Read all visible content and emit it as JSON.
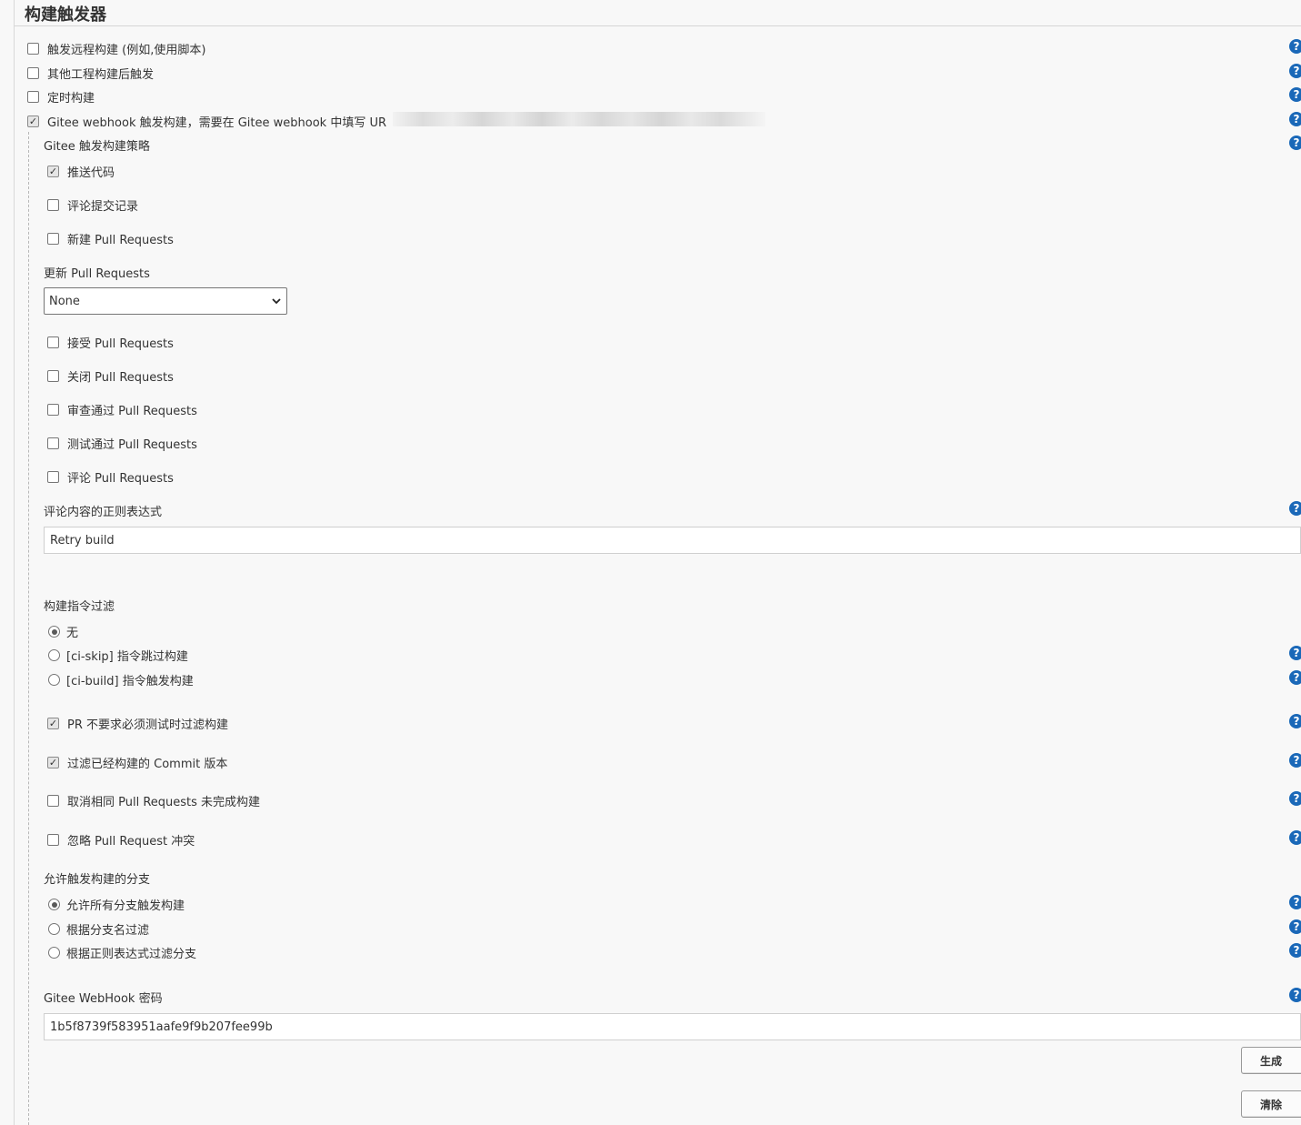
{
  "section": {
    "title": "构建触发器"
  },
  "triggers": [
    {
      "label": "触发远程构建 (例如,使用脚本)",
      "checked": false
    },
    {
      "label": "其他工程构建后触发",
      "checked": false
    },
    {
      "label": "定时构建",
      "checked": false
    },
    {
      "label": "Gitee webhook 触发构建，需要在 Gitee webhook 中填写 UR",
      "checked": true
    }
  ],
  "gitee": {
    "strategy_label": "Gitee 触发构建策略",
    "push_code": "推送代码",
    "comment_commit": "评论提交记录",
    "new_pr": "新建 Pull Requests",
    "update_pr_label": "更新 Pull Requests",
    "update_pr_value": "None",
    "accept_pr": "接受 Pull Requests",
    "close_pr": "关闭 Pull Requests",
    "approve_pr": "审查通过 Pull Requests",
    "test_pr": "测试通过 Pull Requests",
    "comment_pr": "评论 Pull Requests",
    "comment_regex_label": "评论内容的正则表达式",
    "comment_regex_value": "Retry build",
    "build_filter_label": "构建指令过滤",
    "filter_none": "无",
    "filter_ci_skip": "[ci-skip] 指令跳过构建",
    "filter_ci_build": "[ci-build] 指令触发构建",
    "pr_no_test_filter": "PR 不要求必须测试时过滤构建",
    "filter_built_commit": "过滤已经构建的 Commit 版本",
    "cancel_pending": "取消相同 Pull Requests 未完成构建",
    "ignore_conflict": "忽略 Pull Request 冲突",
    "branches_label": "允许触发构建的分支",
    "branch_all": "允许所有分支触发构建",
    "branch_name_filter": "根据分支名过滤",
    "branch_regex_filter": "根据正则表达式过滤分支",
    "secret_label": "Gitee WebHook 密码",
    "secret_value": "1b5f8739f583951aafe9f9b207fee99b",
    "generate_button": "生成",
    "clear_button": "清除"
  },
  "help": {
    "glyph": "?"
  }
}
